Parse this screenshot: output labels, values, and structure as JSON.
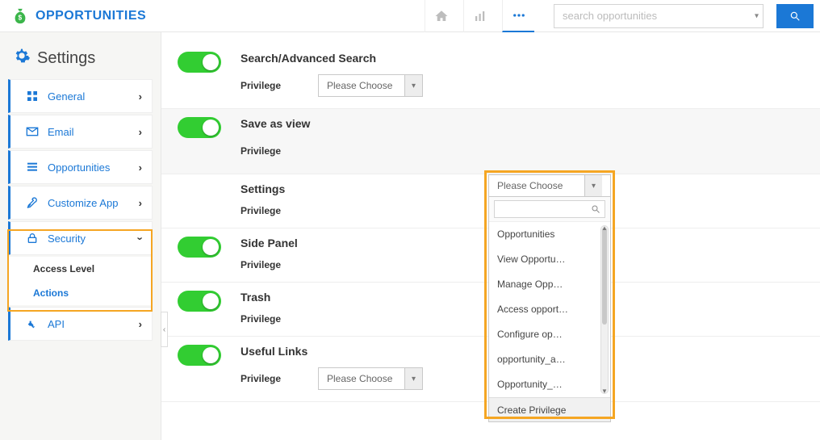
{
  "brand": {
    "title": "OPPORTUNITIES"
  },
  "search": {
    "placeholder": "search opportunities"
  },
  "sidebar": {
    "title": "Settings",
    "items": [
      {
        "label": "General"
      },
      {
        "label": "Email"
      },
      {
        "label": "Opportunities"
      },
      {
        "label": "Customize App"
      },
      {
        "label": "Security"
      },
      {
        "label": "API"
      }
    ],
    "security_sub": [
      {
        "label": "Access Level"
      },
      {
        "label": "Actions"
      }
    ]
  },
  "privilege_label": "Privilege",
  "please_choose": "Please Choose",
  "sections": {
    "search": {
      "title": "Search/Advanced Search"
    },
    "save_view": {
      "title": "Save as view"
    },
    "settings": {
      "title": "Settings"
    },
    "side_panel": {
      "title": "Side Panel"
    },
    "trash": {
      "title": "Trash"
    },
    "useful_links": {
      "title": "Useful Links"
    }
  },
  "dropdown": {
    "options": [
      "Opportunities",
      "View Opportu…",
      "Manage Opp…",
      "Access opport…",
      "Configure op…",
      "opportunity_a…",
      "Opportunity_…"
    ],
    "footer": "Create Privilege"
  }
}
